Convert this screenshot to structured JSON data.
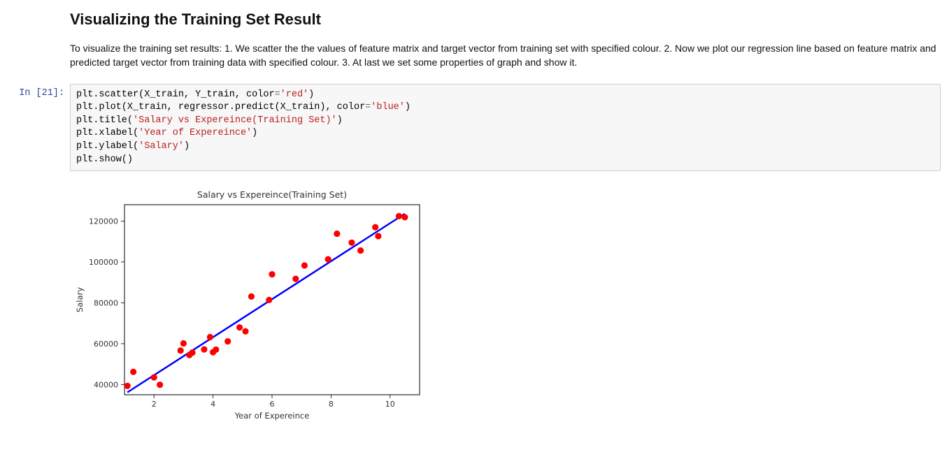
{
  "markdown": {
    "heading": "Visualizing the Training Set Result",
    "paragraph": "To visualize the training set results: 1. We scatter the the values of feature matrix and target vector from training set with specified colour. 2. Now we plot our regression line based on feature matrix and predicted target vector from training data with specified colour. 3. At last we set some properties of graph and show it."
  },
  "code_cell": {
    "prompt": "In [21]:",
    "lines": [
      [
        "plt.scatter(X_train, Y_train, color",
        "=",
        "'red'",
        ")"
      ],
      [
        "plt.plot(X_train, regressor.predict(X_train), color",
        "=",
        "'blue'",
        ")"
      ],
      [
        "plt.title(",
        "'Salary vs Expereince(Training Set)'",
        ")"
      ],
      [
        "plt.xlabel(",
        "'Year of Expereince'",
        ")"
      ],
      [
        "plt.ylabel(",
        "'Salary'",
        ")"
      ],
      [
        "plt.show()"
      ]
    ]
  },
  "chart_data": {
    "type": "scatter_with_line",
    "title": "Salary vs Expereince(Training Set)",
    "xlabel": "Year of Expereince",
    "ylabel": "Salary",
    "xlim": [
      1,
      11
    ],
    "ylim": [
      35000,
      128000
    ],
    "x_ticks": [
      2,
      4,
      6,
      8,
      10
    ],
    "y_ticks": [
      40000,
      60000,
      80000,
      100000,
      120000
    ],
    "scatter": {
      "color": "red",
      "points": [
        {
          "x": 1.1,
          "y": 39343
        },
        {
          "x": 1.3,
          "y": 46205
        },
        {
          "x": 2.0,
          "y": 43525
        },
        {
          "x": 2.2,
          "y": 39891
        },
        {
          "x": 2.9,
          "y": 56642
        },
        {
          "x": 3.0,
          "y": 60150
        },
        {
          "x": 3.2,
          "y": 54445
        },
        {
          "x": 3.3,
          "y": 55600
        },
        {
          "x": 3.7,
          "y": 57189
        },
        {
          "x": 3.9,
          "y": 63218
        },
        {
          "x": 4.0,
          "y": 55794
        },
        {
          "x": 4.1,
          "y": 57081
        },
        {
          "x": 4.5,
          "y": 61111
        },
        {
          "x": 4.9,
          "y": 67938
        },
        {
          "x": 5.1,
          "y": 66029
        },
        {
          "x": 5.3,
          "y": 83088
        },
        {
          "x": 5.9,
          "y": 81363
        },
        {
          "x": 6.0,
          "y": 93940
        },
        {
          "x": 6.8,
          "y": 91738
        },
        {
          "x": 7.1,
          "y": 98273
        },
        {
          "x": 7.9,
          "y": 101302
        },
        {
          "x": 8.2,
          "y": 113812
        },
        {
          "x": 8.7,
          "y": 109431
        },
        {
          "x": 9.0,
          "y": 105582
        },
        {
          "x": 9.5,
          "y": 116969
        },
        {
          "x": 9.6,
          "y": 112635
        },
        {
          "x": 10.3,
          "y": 122391
        },
        {
          "x": 10.5,
          "y": 121872
        }
      ]
    },
    "line": {
      "color": "blue",
      "start": {
        "x": 1.1,
        "y": 36200
      },
      "end": {
        "x": 10.5,
        "y": 123600
      }
    }
  }
}
